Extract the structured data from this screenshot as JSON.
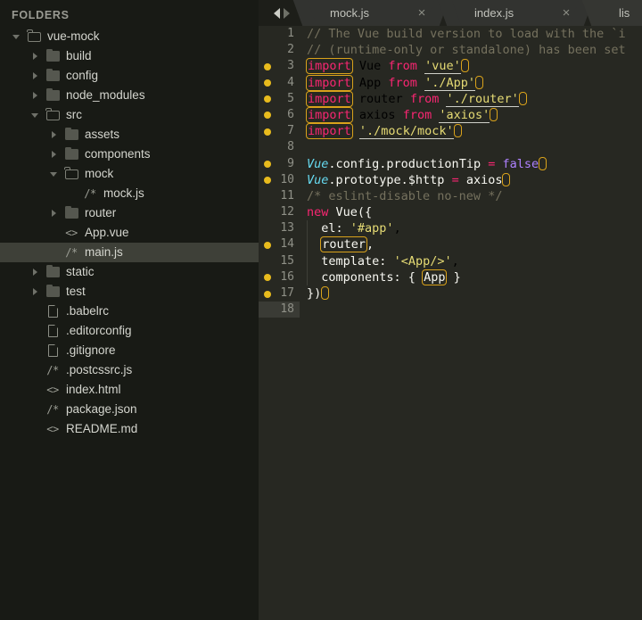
{
  "sidebar": {
    "title": "FOLDERS",
    "tree": [
      {
        "label": "vue-mock",
        "indent": 0,
        "twisty": "down",
        "icon": "folder-open",
        "selected": false
      },
      {
        "label": "build",
        "indent": 1,
        "twisty": "right",
        "icon": "folder-closed",
        "selected": false
      },
      {
        "label": "config",
        "indent": 1,
        "twisty": "right",
        "icon": "folder-closed",
        "selected": false
      },
      {
        "label": "node_modules",
        "indent": 1,
        "twisty": "right",
        "icon": "folder-closed",
        "selected": false
      },
      {
        "label": "src",
        "indent": 1,
        "twisty": "down",
        "icon": "folder-open",
        "selected": false
      },
      {
        "label": "assets",
        "indent": 2,
        "twisty": "right",
        "icon": "folder-closed",
        "selected": false
      },
      {
        "label": "components",
        "indent": 2,
        "twisty": "right",
        "icon": "folder-closed",
        "selected": false
      },
      {
        "label": "mock",
        "indent": 2,
        "twisty": "down",
        "icon": "folder-open",
        "selected": false
      },
      {
        "label": "mock.js",
        "indent": 3,
        "twisty": "none",
        "icon": "js-icon",
        "selected": false
      },
      {
        "label": "router",
        "indent": 2,
        "twisty": "right",
        "icon": "folder-closed",
        "selected": false
      },
      {
        "label": "App.vue",
        "indent": 2,
        "twisty": "none",
        "icon": "markup-icon",
        "selected": false
      },
      {
        "label": "main.js",
        "indent": 2,
        "twisty": "none",
        "icon": "js-icon",
        "selected": true
      },
      {
        "label": "static",
        "indent": 1,
        "twisty": "right",
        "icon": "folder-closed",
        "selected": false
      },
      {
        "label": "test",
        "indent": 1,
        "twisty": "right",
        "icon": "folder-closed",
        "selected": false
      },
      {
        "label": ".babelrc",
        "indent": 1,
        "twisty": "none",
        "icon": "page-icon",
        "selected": false
      },
      {
        "label": ".editorconfig",
        "indent": 1,
        "twisty": "none",
        "icon": "page-icon",
        "selected": false
      },
      {
        "label": ".gitignore",
        "indent": 1,
        "twisty": "none",
        "icon": "page-icon",
        "selected": false
      },
      {
        "label": ".postcssrc.js",
        "indent": 1,
        "twisty": "none",
        "icon": "js-icon",
        "selected": false
      },
      {
        "label": "index.html",
        "indent": 1,
        "twisty": "none",
        "icon": "markup-icon",
        "selected": false
      },
      {
        "label": "package.json",
        "indent": 1,
        "twisty": "none",
        "icon": "js-icon",
        "selected": false
      },
      {
        "label": "README.md",
        "indent": 1,
        "twisty": "none",
        "icon": "markup-icon",
        "selected": false
      }
    ],
    "icon_glyphs": {
      "js-icon": "/*",
      "markup-icon": "<>"
    }
  },
  "editor": {
    "nav": {
      "back_label": "◀",
      "forward_label": "▶"
    },
    "tabs": [
      {
        "label": "mock.js",
        "close": "×",
        "active": false
      },
      {
        "label": "index.js",
        "close": "×",
        "active": false
      },
      {
        "label": "lis",
        "close": "",
        "active": true
      }
    ],
    "current_line": 18,
    "lines": [
      {
        "n": 1,
        "marker": false,
        "cur": false
      },
      {
        "n": 2,
        "marker": false,
        "cur": false
      },
      {
        "n": 3,
        "marker": true,
        "cur": false
      },
      {
        "n": 4,
        "marker": true,
        "cur": false
      },
      {
        "n": 5,
        "marker": true,
        "cur": false
      },
      {
        "n": 6,
        "marker": true,
        "cur": false
      },
      {
        "n": 7,
        "marker": true,
        "cur": false
      },
      {
        "n": 8,
        "marker": false,
        "cur": false
      },
      {
        "n": 9,
        "marker": true,
        "cur": false
      },
      {
        "n": 10,
        "marker": true,
        "cur": false
      },
      {
        "n": 11,
        "marker": false,
        "cur": false
      },
      {
        "n": 12,
        "marker": false,
        "cur": false
      },
      {
        "n": 13,
        "marker": false,
        "cur": false
      },
      {
        "n": 14,
        "marker": true,
        "cur": false
      },
      {
        "n": 15,
        "marker": false,
        "cur": false
      },
      {
        "n": 16,
        "marker": true,
        "cur": false
      },
      {
        "n": 17,
        "marker": true,
        "cur": false
      },
      {
        "n": 18,
        "marker": false,
        "cur": true
      }
    ],
    "code": [
      "// The Vue build version to load with the `i",
      "// (runtime-only or standalone) has been set",
      "import Vue from 'vue'",
      "import App from './App'",
      "import router from './router'",
      "import axios from 'axios'",
      "import './mock/mock'",
      "",
      "Vue.config.productionTip = false",
      "Vue.prototype.$http = axios",
      "/* eslint-disable no-new */",
      "new Vue({",
      "  el: '#app',",
      "  router,",
      "  template: '<App/>',",
      "  components: { App }",
      "})",
      ""
    ]
  },
  "colors": {
    "sidebar_bg": "#181a15",
    "editor_bg": "#272822",
    "tabbar_bg": "#20211c",
    "tab_bg": "#323330",
    "selection_bg": "#3e4038",
    "gutter_marker": "#e8bb1d",
    "lint_box": "#d9a21b",
    "keyword": "#f92672",
    "string": "#e6db74",
    "comment": "#75715e",
    "entity": "#66d9ef",
    "constant": "#ae81ff",
    "plain": "#f8f8f2"
  }
}
